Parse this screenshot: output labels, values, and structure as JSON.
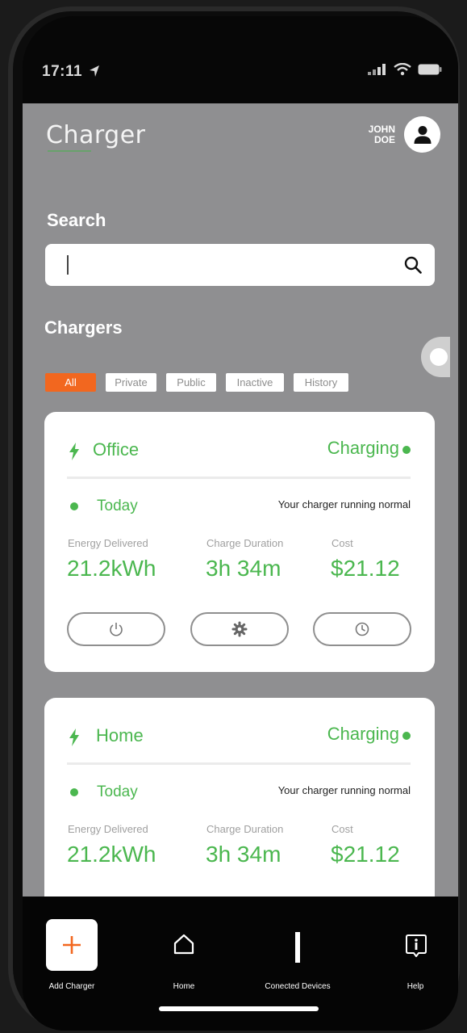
{
  "status_bar": {
    "time": "17:11"
  },
  "header": {
    "brand": "Charger",
    "user_name_line1": "JOHN",
    "user_name_line2": "DOE"
  },
  "search": {
    "title": "Search",
    "value": "",
    "placeholder": ""
  },
  "chargers": {
    "title": "Chargers",
    "filters": [
      "All",
      "Private",
      "Public",
      "Inactive",
      "History"
    ],
    "active_filter": "All"
  },
  "cards": [
    {
      "name": "Office",
      "status": "Charging",
      "period": "Today",
      "message": "Your charger running normal",
      "stats": [
        {
          "label": "Energy Delivered",
          "value": "21.2kWh"
        },
        {
          "label": "Charge Duration",
          "value": "3h 34m"
        },
        {
          "label": "Cost",
          "value": "$21.12"
        }
      ]
    },
    {
      "name": "Home",
      "status": "Charging",
      "period": "Today",
      "message": "Your charger running normal",
      "stats": [
        {
          "label": "Energy Delivered",
          "value": "21.2kWh"
        },
        {
          "label": "Charge Duration",
          "value": "3h 34m"
        },
        {
          "label": "Cost",
          "value": "$21.12"
        }
      ]
    }
  ],
  "bottom_nav": [
    {
      "label": "Add Charger",
      "icon": "plus-icon"
    },
    {
      "label": "Home",
      "icon": "home-icon"
    },
    {
      "label": "Conected Devices",
      "icon": "charger-plug-icon"
    },
    {
      "label": "Help",
      "icon": "info-icon"
    }
  ],
  "colors": {
    "accent_green": "#4bb74f",
    "accent_orange": "#f2671f",
    "background_gray": "#8f8f91"
  }
}
